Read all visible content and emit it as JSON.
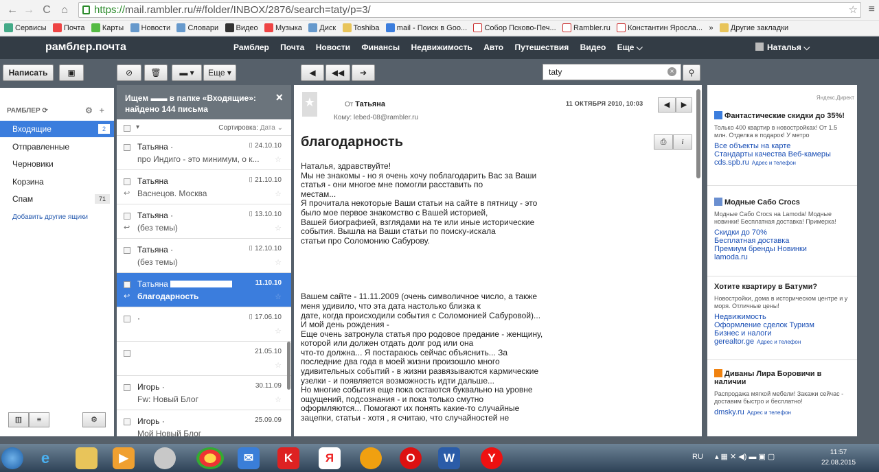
{
  "browser": {
    "url_scheme": "https://",
    "url_rest": "mail.rambler.ru/#/folder/INBOX/2876/search=taty/p=3/",
    "bookmarks": [
      "Сервисы",
      "Почта",
      "Карты",
      "Новости",
      "Словари",
      "Видео",
      "Музыка",
      "Диск",
      "Toshiba",
      "mail - Поиск в Goo...",
      "Собор Псково-Печ...",
      "Rambler.ru",
      "Константин Яросла...",
      "»",
      "Другие закладки"
    ]
  },
  "header": {
    "logo": "рамблер.почта",
    "nav": [
      "Рамблер",
      "Почта",
      "Новости",
      "Финансы",
      "Недвижимость",
      "Авто",
      "Путешествия",
      "Видео",
      "Еще ⌵"
    ],
    "user": "Наталья ⌵"
  },
  "toolbar": {
    "compose": "Написать",
    "more": "Еще ▾",
    "search_value": "taty"
  },
  "sidebar": {
    "heading": "РАМБЛЕР ⟳",
    "folders": [
      {
        "label": "Входящие",
        "count": "2"
      },
      {
        "label": "Отправленные",
        "count": ""
      },
      {
        "label": "Черновики",
        "count": ""
      },
      {
        "label": "Корзина",
        "count": ""
      },
      {
        "label": "Спам",
        "count": "71"
      }
    ],
    "add_boxes": "Добавить другие ящики"
  },
  "list": {
    "search_line1": "Ищем ▬▬ в папке «Входящие»:",
    "search_line2": "найдено 144 письма",
    "sort_label": "Сортировка:",
    "sort_value": "Дата ⌄",
    "messages": [
      {
        "from": "Татьяна ·",
        "date": "24.10.10",
        "subject": "про Индиго - это минимум, о к..."
      },
      {
        "from": "Татьяна",
        "date": "21.10.10",
        "subject": "Васнецов. Москва"
      },
      {
        "from": "Татьяна ·",
        "date": "13.10.10",
        "subject": "(без темы)"
      },
      {
        "from": "Татьяна ·",
        "date": "12.10.10",
        "subject": "(без темы)"
      },
      {
        "from": "Татьяна",
        "date": "11.10.10",
        "subject": "благодарность"
      },
      {
        "from": "·",
        "date": "17.06.10",
        "subject": ""
      },
      {
        "from": "",
        "date": "21.05.10",
        "subject": ""
      },
      {
        "from": "Игорь ·",
        "date": "30.11.09",
        "subject": "Fw: Новый Блог"
      },
      {
        "from": "Игорь ·",
        "date": "25.09.09",
        "subject": "Мой Новый Блог"
      }
    ]
  },
  "reader": {
    "from_prefix": "От",
    "from_name": "Татьяна",
    "to": "Кому: lebed-08@rambler.ru",
    "date": "11 ОКТЯБРЯ 2010, 10:03",
    "subject": "благодарность",
    "body": "Наталья, здравствуйте!\nМы не знакомы - но я очень хочу поблагодарить Вас за Ваши статья - они многое мне помогли расставить по\nместам...\nЯ прочитала некоторые Ваши статьи на сайте в пятницу - это было мое первое знакомство с Вашей историей,\nВашей биографией, взглядами на те или иные исторические события. Вышла на Ваши статьи по поиску-искала\nстатьи про Соломонию Сабурову.\n\n\n\n\n\nВашем сайте - 11.11.2009 (очень символичное число, а также меня удивило, что эта дата настолько близка к\nдате, когда происходили события с Соломонией Сабуровой)...\nИ мой день рождения -\n   Еще очень затронула статья про родовое предание - женщину, которой или должен отдать долг род или она\nчто-то должна... Я постараюсь сейчас объяснить... За последние два года в моей жизни произошло много\nудивительных событий - в жизни развязываются кармические узелки - и появляется возможность идти дальше...\nНо многие события еще пока остаются буквально на уровне ощущений, подсознания - и пока только смутно\nоформляются... Помогают их понять какие-то случайные зацепки, статьи - хотя , я считаю, что случайностей не"
  },
  "ads": {
    "label": "Яндекс.Директ",
    "items": [
      {
        "title": "Фантастические скидки до 35%!",
        "text": "Только 400 квартир в новостройках! От 1.5 млн. Отделка в подарок! У метро",
        "links": [
          "Все объекты на карте",
          "Стандарты качества   Веб-камеры"
        ],
        "domain": "cds.spb.ru",
        "addr": "Адрес и телефон"
      },
      {
        "title": "Модные Сабо Crocs",
        "text": "Модные Сабо Crocs на Lamoda! Модные новинки! Бесплатная доставка! Примерка!",
        "links": [
          "Скидки до 70%",
          "Бесплатная доставка",
          "Премиум бренды   Новинки"
        ],
        "domain": "lamoda.ru",
        "addr": ""
      },
      {
        "title": "Хотите квартиру в Батуми?",
        "text": "Новостройки, дома в историческом центре и у моря. Отличные цены!",
        "links": [
          "Недвижимость",
          "Оформление сделок   Туризм",
          "Бизнес и налоги"
        ],
        "domain": "gerealtor.ge",
        "addr": "Адрес и телефон"
      },
      {
        "title": "Диваны Лира Боровичи в наличии",
        "text": "Распродажа мягкой мебели! Закажи сейчас - доставим быстро и бесплатно!",
        "links": [],
        "domain": "dmsky.ru",
        "addr": "Адрес и телефон"
      }
    ]
  },
  "taskbar": {
    "lang": "RU",
    "time": "11:57",
    "date": "22.08.2015"
  }
}
